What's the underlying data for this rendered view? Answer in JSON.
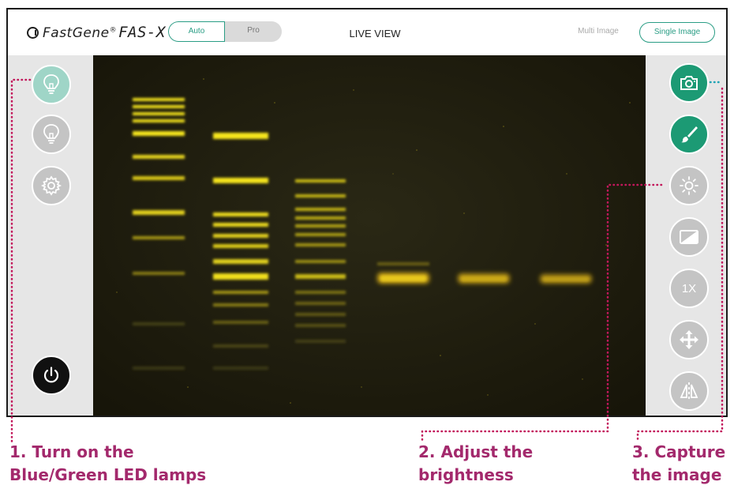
{
  "header": {
    "brand": "FastGene",
    "brand_mark": "®",
    "model": "FAS-X",
    "mode_toggle": {
      "auto": "Auto",
      "pro": "Pro",
      "selected": "Auto"
    },
    "view_title": "LIVE VIEW",
    "image_modes": {
      "multi": "Multi Image",
      "single": "Single Image",
      "selected": "Single Image"
    }
  },
  "left_toolbar": {
    "buttons": [
      {
        "icon": "bulb-icon",
        "state": "active"
      },
      {
        "icon": "bulb-icon",
        "state": "inactive"
      },
      {
        "icon": "gear-icon"
      },
      {
        "icon": "power-icon"
      }
    ]
  },
  "right_toolbar": {
    "buttons": [
      {
        "icon": "camera-icon",
        "state": "primary"
      },
      {
        "icon": "brush-icon",
        "state": "primary"
      },
      {
        "icon": "brightness-icon"
      },
      {
        "icon": "contrast-icon"
      },
      {
        "icon": "zoom-level",
        "label": "1X"
      },
      {
        "icon": "move-icon"
      },
      {
        "icon": "flip-icon"
      }
    ]
  },
  "live_image": {
    "description_colors": {
      "background": "#1f1d10",
      "band": "#f2e31c"
    },
    "lanes": 6
  },
  "annotations": [
    {
      "number": "1.",
      "line1": "Turn on the",
      "line2": "Blue/Green LED lamps"
    },
    {
      "number": "2.",
      "line1": "Adjust the",
      "line2": "brightness"
    },
    {
      "number": "3.",
      "line1": "Capture",
      "line2": "the image"
    }
  ],
  "colors": {
    "accent": "#1c9a74",
    "annotation": "#a3296c",
    "dotted_left": "#c2185b",
    "dotted_right": "#1fa3b5"
  }
}
